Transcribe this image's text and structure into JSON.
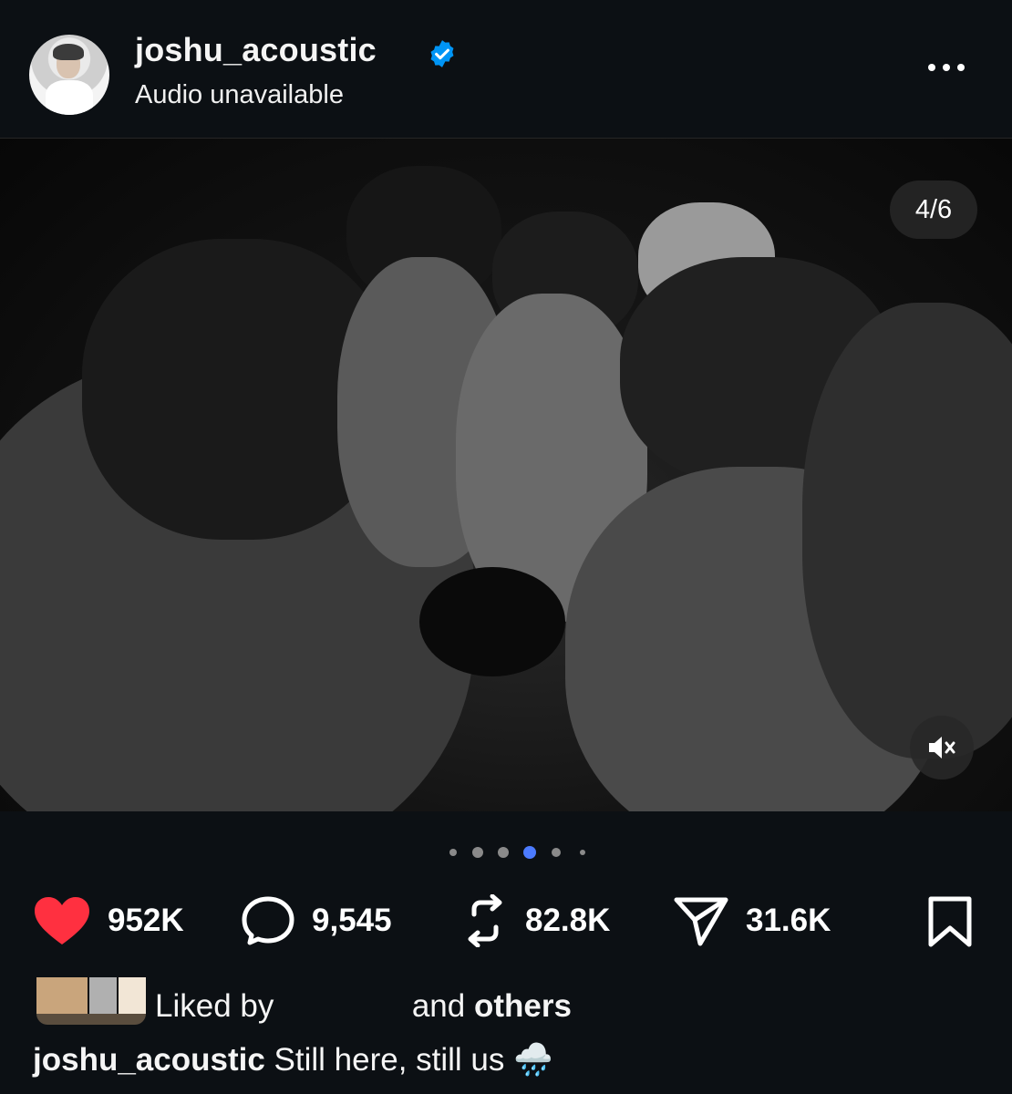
{
  "header": {
    "username": "joshu_acoustic",
    "subtitle": "Audio unavailable"
  },
  "media": {
    "counter": "4/6",
    "current_index": 4,
    "total": 6
  },
  "actions": {
    "likes": "952K",
    "comments": "9,545",
    "reposts": "82.8K",
    "shares": "31.6K"
  },
  "liked_by": {
    "prefix": "Liked by",
    "middle": "and",
    "others": "others"
  },
  "caption": {
    "username": "joshu_acoustic",
    "text": "Still here, still us",
    "emoji": "🌧️"
  },
  "colors": {
    "background": "#0c1014",
    "like": "#ff3040",
    "verified": "#0095f6",
    "active_dot": "#4c7bff"
  },
  "icons": {
    "verified": "verified-badge-icon",
    "more": "more-options-icon",
    "like": "heart-icon",
    "comment": "comment-icon",
    "repost": "repost-icon",
    "share": "send-icon",
    "bookmark": "bookmark-icon",
    "mute": "mute-icon"
  }
}
